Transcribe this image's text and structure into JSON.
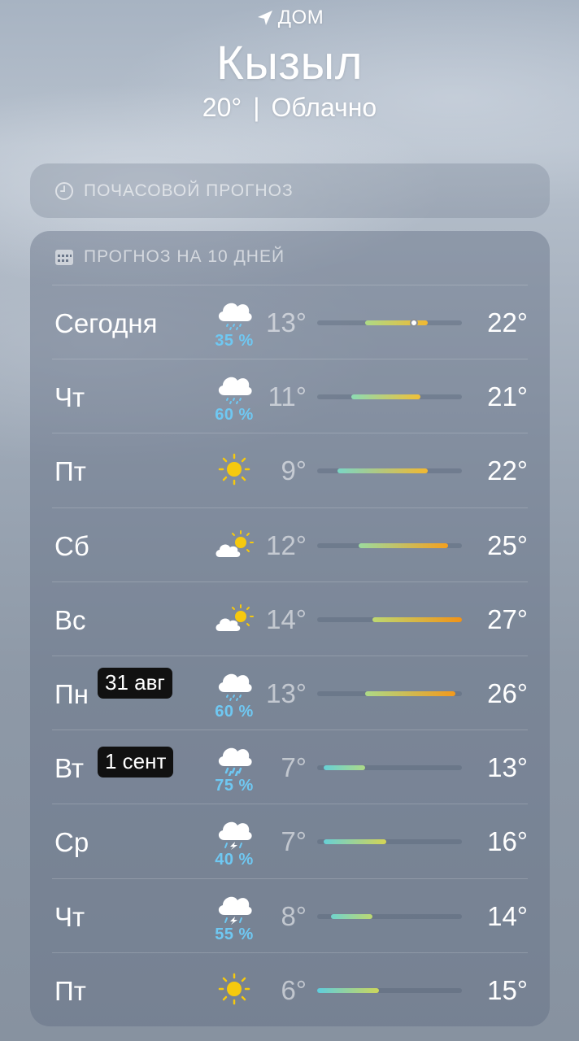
{
  "header": {
    "location_label": "ДОМ",
    "city": "Кызыл",
    "temperature": "20°",
    "separator": "|",
    "condition": "Облачно"
  },
  "hourly": {
    "label": "ПОЧАСОВОЙ ПРОГНОЗ"
  },
  "forecast": {
    "label": "ПРОГНОЗ НА 10 ДНЕЙ",
    "range_min": 6,
    "range_max": 27,
    "days": [
      {
        "day": "Сегодня",
        "icon": "cloud-drizzle-icon",
        "precip": "35 %",
        "low": "13°",
        "high": "22°",
        "lo": 13,
        "hi": 22,
        "current": 20
      },
      {
        "day": "Чт",
        "icon": "cloud-drizzle-icon",
        "precip": "60 %",
        "low": "11°",
        "high": "21°",
        "lo": 11,
        "hi": 21
      },
      {
        "day": "Пт",
        "icon": "sun-icon",
        "precip": "",
        "low": "9°",
        "high": "22°",
        "lo": 9,
        "hi": 22
      },
      {
        "day": "Сб",
        "icon": "partly-sunny-icon",
        "precip": "",
        "low": "12°",
        "high": "25°",
        "lo": 12,
        "hi": 25
      },
      {
        "day": "Вс",
        "icon": "partly-sunny-icon",
        "precip": "",
        "low": "14°",
        "high": "27°",
        "lo": 14,
        "hi": 27
      },
      {
        "day": "Пн",
        "icon": "cloud-drizzle-icon",
        "precip": "60 %",
        "low": "13°",
        "high": "26°",
        "lo": 13,
        "hi": 26,
        "badge": "31 авг"
      },
      {
        "day": "Вт",
        "icon": "cloud-rain-icon",
        "precip": "75 %",
        "low": "7°",
        "high": "13°",
        "lo": 7,
        "hi": 13,
        "badge": "1 сент"
      },
      {
        "day": "Ср",
        "icon": "cloud-thunderstorm-icon",
        "precip": "40 %",
        "low": "7°",
        "high": "16°",
        "lo": 7,
        "hi": 16
      },
      {
        "day": "Чт",
        "icon": "cloud-thunderstorm-icon",
        "precip": "55 %",
        "low": "8°",
        "high": "14°",
        "lo": 8,
        "hi": 14
      },
      {
        "day": "Пт",
        "icon": "sun-icon",
        "precip": "",
        "low": "6°",
        "high": "15°",
        "lo": 6,
        "hi": 15
      }
    ]
  }
}
